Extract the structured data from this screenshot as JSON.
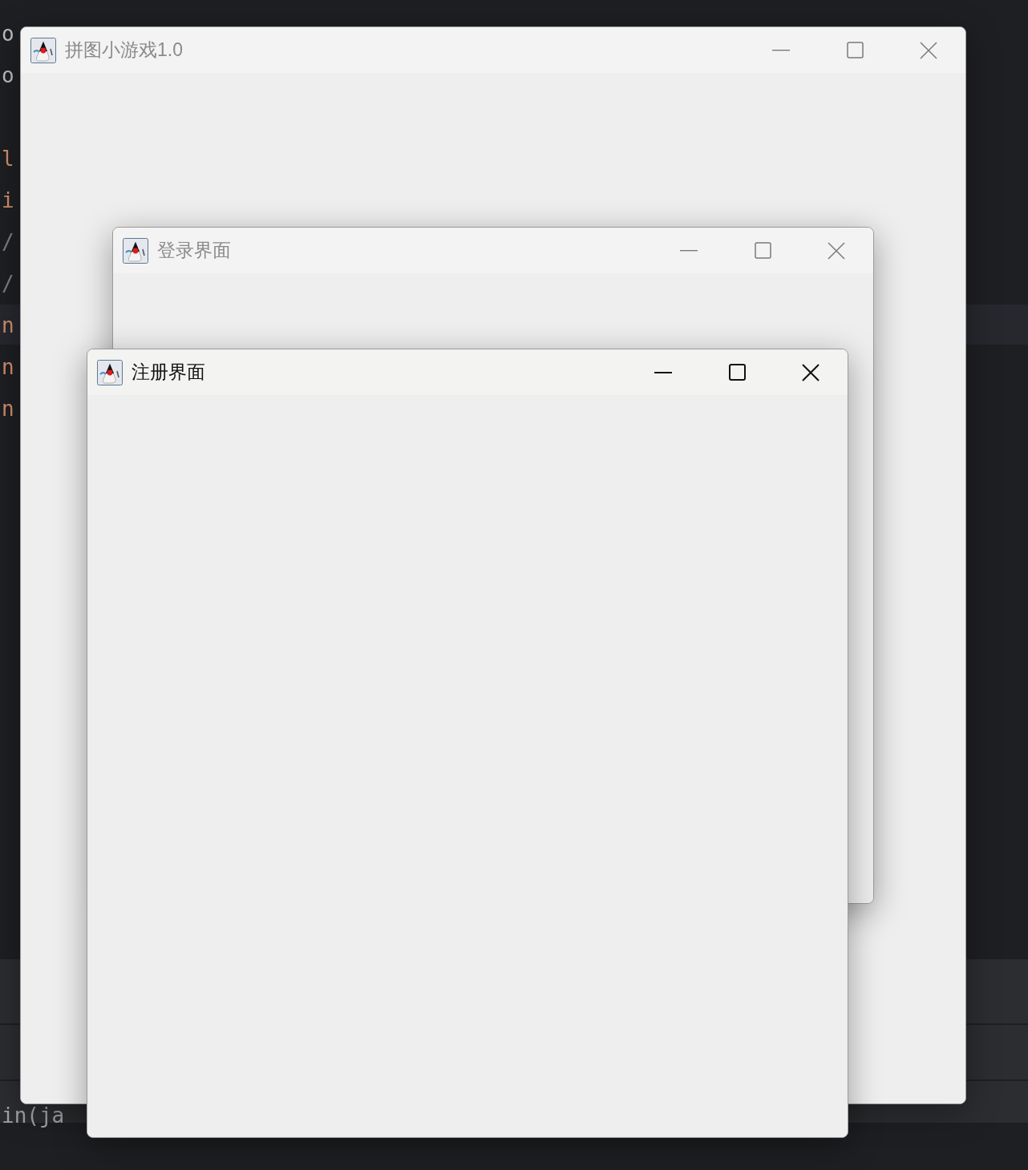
{
  "editor": {
    "code_fragments": [
      {
        "text": "o",
        "color": "#bcbec4"
      },
      {
        "text": "o",
        "color": "#bcbec4"
      },
      {
        "text": "l",
        "color": "#cf8e6d"
      },
      {
        "text": "i",
        "color": "#cf8e6d"
      },
      {
        "text": "/",
        "color": "#7a7e85"
      },
      {
        "text": "/",
        "color": "#7a7e85"
      },
      {
        "text": "n",
        "color": "#cf8e6d"
      },
      {
        "text": "n",
        "color": "#cf8e6d"
      },
      {
        "text": "n",
        "color": "#cf8e6d"
      },
      {
        "text": "in(ja",
        "color": "#a0a4ab"
      }
    ]
  },
  "windows": [
    {
      "title": "拼图小游戏1.0",
      "active": false
    },
    {
      "title": "登录界面",
      "active": false
    },
    {
      "title": "注册界面",
      "active": true
    }
  ]
}
